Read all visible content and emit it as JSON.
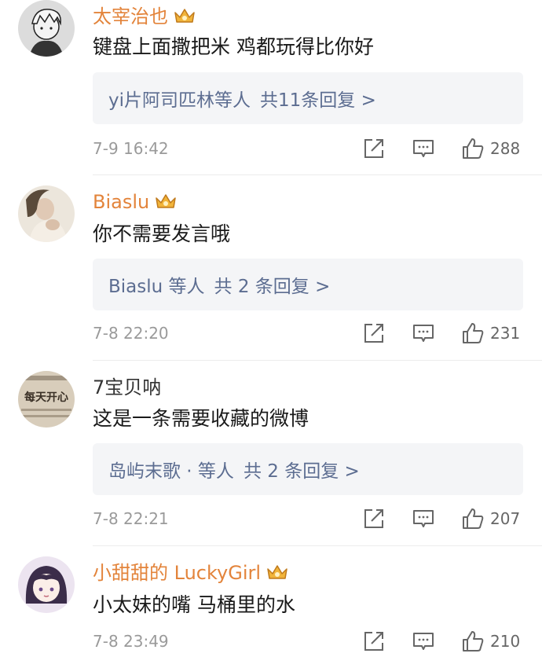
{
  "comments": [
    {
      "username": "太宰治也",
      "vip": true,
      "avatar": "anime-boy-avatar",
      "text": "键盘上面撒把米 鸡都玩得比你好",
      "replies_names": "yi片阿司匹林等人",
      "replies_total": "共11条回复 >",
      "time": "7-9 16:42",
      "likes": "288"
    },
    {
      "username": "Biaslu",
      "vip": true,
      "avatar": "photo-avatar",
      "text": "你不需要发言哦",
      "replies_names": "Biaslu 等人",
      "replies_total": "共 2 条回复 >",
      "time": "7-8 22:20",
      "likes": "231"
    },
    {
      "username": "7宝贝呐",
      "vip": false,
      "avatar": "newspaper-avatar",
      "avatar_text": "每天开心",
      "text": "这是一条需要收藏的微博",
      "replies_names": "岛屿末歌 · 等人",
      "replies_total": "共 2 条回复 >",
      "time": "7-8 22:21",
      "likes": "207"
    },
    {
      "username": "小甜甜的 LuckyGirl",
      "vip": true,
      "avatar": "anime-girl-avatar",
      "text": "小太妹的嘴 马桶里的水",
      "time": "7-8 23:49",
      "likes": "210"
    }
  ],
  "colors": {
    "vip_name": "#e3843b",
    "reply_link": "#5c6d91",
    "meta": "#9a9a9a"
  },
  "icons": [
    "crown-vip-icon",
    "share-icon",
    "comment-icon",
    "like-icon"
  ]
}
